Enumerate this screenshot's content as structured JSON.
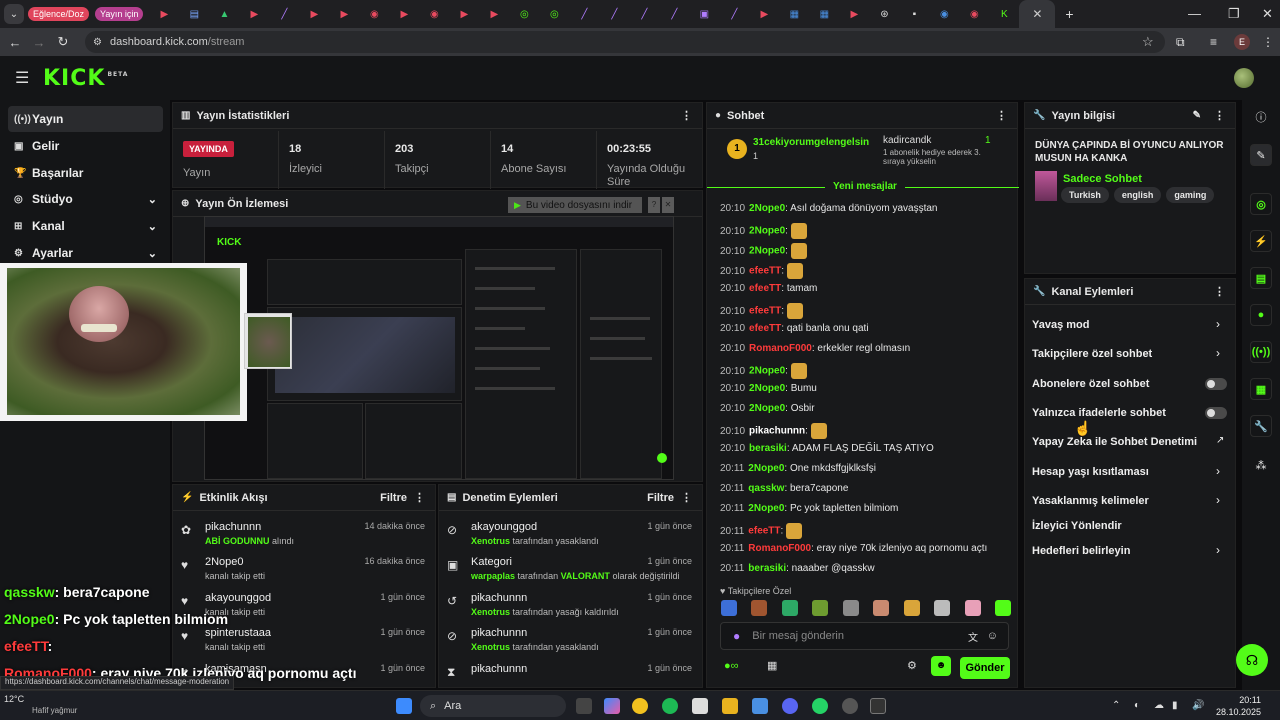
{
  "browser": {
    "tab_pill_1": "Eğlence/Doz",
    "tab_pill_2": "Yayın için",
    "url_host": "dashboard.kick.com",
    "url_path": "/stream",
    "profile_initial": "E",
    "status_url": "https://dashboard.kick.com/channels/chat/message-moderation"
  },
  "header": {
    "logo": "KICK",
    "logo_tag": "BETA"
  },
  "sidebar": {
    "items": [
      {
        "label": "Yayın"
      },
      {
        "label": "Gelir"
      },
      {
        "label": "Başarılar"
      },
      {
        "label": "Stüdyo"
      },
      {
        "label": "Kanal"
      },
      {
        "label": "Ayarlar"
      }
    ]
  },
  "stats": {
    "title": "Yayın İstatistikleri",
    "live_badge": "YAYINDA",
    "live_label": "Yayın",
    "viewers": "18",
    "viewers_label": "İzleyici",
    "followers": "203",
    "followers_label": "Takipçi",
    "subs": "14",
    "subs_label": "Abone Sayısı",
    "duration": "00:23:55",
    "duration_label": "Yayında Olduğu Süre"
  },
  "preview": {
    "title": "Yayın Ön İzlemesi",
    "download": "Bu video dosyasını indir"
  },
  "activity": {
    "title": "Etkinlik Akışı",
    "filter": "Filtre",
    "items": [
      {
        "name": "pikachunnn",
        "sub_hl": "ABİ GODUNNU",
        "sub": "alındı",
        "time": "14 dakika önce"
      },
      {
        "name": "2Nope0",
        "sub": "kanalı takip etti",
        "time": "16 dakika önce"
      },
      {
        "name": "akayounggod",
        "sub": "kanalı takip etti",
        "time": "1 gün önce"
      },
      {
        "name": "spinterustaaa",
        "sub": "kanalı takip etti",
        "time": "1 gün önce"
      },
      {
        "name": "kamisamasn",
        "sub": "",
        "time": "1 gün önce"
      }
    ]
  },
  "moderation": {
    "title": "Denetim Eylemleri",
    "filter": "Filtre",
    "items": [
      {
        "name": "akayounggod",
        "actor": "Xenotrus",
        "sub": "tarafından yasaklandı",
        "time": "1 gün önce"
      },
      {
        "name": "Kategori",
        "actor": "warpaplas",
        "sub": "tarafından",
        "cat": "VALORANT",
        "sub2": "olarak değiştirildi",
        "time": "1 gün önce"
      },
      {
        "name": "pikachunnn",
        "actor": "Xenotrus",
        "sub": "tarafından yasağı kaldırıldı",
        "time": "1 gün önce"
      },
      {
        "name": "pikachunnn",
        "actor": "Xenotrus",
        "sub": "tarafından yasaklandı",
        "time": "1 gün önce"
      },
      {
        "name": "pikachunnn",
        "actor": "",
        "sub": "",
        "time": "1 gün önce"
      }
    ]
  },
  "chat": {
    "title": "Sohbet",
    "pinned_user": "31cekiyorumgelengelsin",
    "pinned_count": "1",
    "gifter": "kadircandk",
    "gifter_count": "1",
    "gift_text": "1 abonelik hediye ederek 3. sıraya yükselin",
    "new_msgs": "Yeni mesajlar",
    "followers_only": "Takipçilere Özel",
    "placeholder": "Bir mesaj gönderin",
    "send": "Gönder",
    "messages": [
      {
        "t": "20:10",
        "u": "2Nope0",
        "c": "#53fc18",
        "m": ": Asıl doğama dönüyom yavaşştan"
      },
      {
        "t": "20:10",
        "u": "2Nope0",
        "c": "#53fc18",
        "m": ":"
      },
      {
        "t": "20:10",
        "u": "2Nope0",
        "c": "#53fc18",
        "m": ":"
      },
      {
        "t": "20:10",
        "u": "efeeTT",
        "c": "#ff3b3b",
        "m": ":"
      },
      {
        "t": "20:10",
        "u": "efeeTT",
        "c": "#ff3b3b",
        "m": ": tamam"
      },
      {
        "t": "20:10",
        "u": "efeeTT",
        "c": "#ff3b3b",
        "m": ":"
      },
      {
        "t": "20:10",
        "u": "efeeTT",
        "c": "#ff3b3b",
        "m": ": qati banla onu qati"
      },
      {
        "t": "20:10",
        "u": "RomanoF000",
        "c": "#ff3b3b",
        "m": ": erkekler regl olmasın"
      },
      {
        "t": "20:10",
        "u": "2Nope0",
        "c": "#53fc18",
        "m": ":"
      },
      {
        "t": "20:10",
        "u": "2Nope0",
        "c": "#53fc18",
        "m": ": Bumu"
      },
      {
        "t": "20:10",
        "u": "2Nope0",
        "c": "#53fc18",
        "m": ": Osbir"
      },
      {
        "t": "20:10",
        "u": "pikachunnn",
        "c": "#ffffff",
        "m": ":"
      },
      {
        "t": "20:10",
        "u": "berasiki",
        "c": "#53fc18",
        "m": ": ADAM FLAŞ DEĞİL TAŞ ATIYO"
      },
      {
        "t": "20:11",
        "u": "2Nope0",
        "c": "#53fc18",
        "m": ": One mkdsffgjklksfşi"
      },
      {
        "t": "20:11",
        "u": "qasskw",
        "c": "#53fc18",
        "m": ": bera7capone"
      },
      {
        "t": "20:11",
        "u": "2Nope0",
        "c": "#53fc18",
        "m": ": Pc yok tapletten bilmiom"
      },
      {
        "t": "20:11",
        "u": "efeeTT",
        "c": "#ff3b3b",
        "m": ":"
      },
      {
        "t": "20:11",
        "u": "RomanoF000",
        "c": "#ff3b3b",
        "m": ": eray niye 70k izleniyo aq pornomu açtı"
      },
      {
        "t": "20:11",
        "u": "berasiki",
        "c": "#53fc18",
        "m": ": naaaber @qasskw"
      }
    ]
  },
  "info": {
    "title": "Yayın bilgisi",
    "stream_title": "DÜNYA ÇAPINDA Bİ OYUNCU ANLIYOR MUSUN HA KANKA",
    "category": "Sadece Sohbet",
    "tags": [
      "Turkish",
      "english",
      "gaming"
    ]
  },
  "actions": {
    "title": "Kanal Eylemleri",
    "items": [
      "Yavaş mod",
      "Takipçilere özel sohbet",
      "Abonelere özel sohbet",
      "Yalnızca ifadelerle sohbet",
      "Yapay Zeka ile Sohbet Denetimi",
      "Hesap yaşı kısıtlaması",
      "Yasaklanmış kelimeler",
      "İzleyici Yönlendir",
      "Hedefleri belirleyin"
    ]
  },
  "overlay": [
    {
      "u": "qasskw",
      "m": ": bera7capone",
      "c": "#53fc18"
    },
    {
      "u": "2Nope0",
      "m": ": Pc yok tapletten bilmiom",
      "c": "#53fc18"
    },
    {
      "u": "efeeTT",
      "m": ":",
      "c": "#ff3b3b"
    },
    {
      "u": "RomanoF000",
      "m": ": eray niye 70k izleniyo aq pornomu açtı",
      "c": "#ff3b3b"
    },
    {
      "u": "berasiki",
      "m": ": naaaber @qasskw",
      "c": "#53fc18"
    }
  ],
  "taskbar": {
    "search": "Ara",
    "temp": "12°C",
    "weather": "Hafif yağmur",
    "time": "20:11",
    "date": "28.10.2025"
  }
}
